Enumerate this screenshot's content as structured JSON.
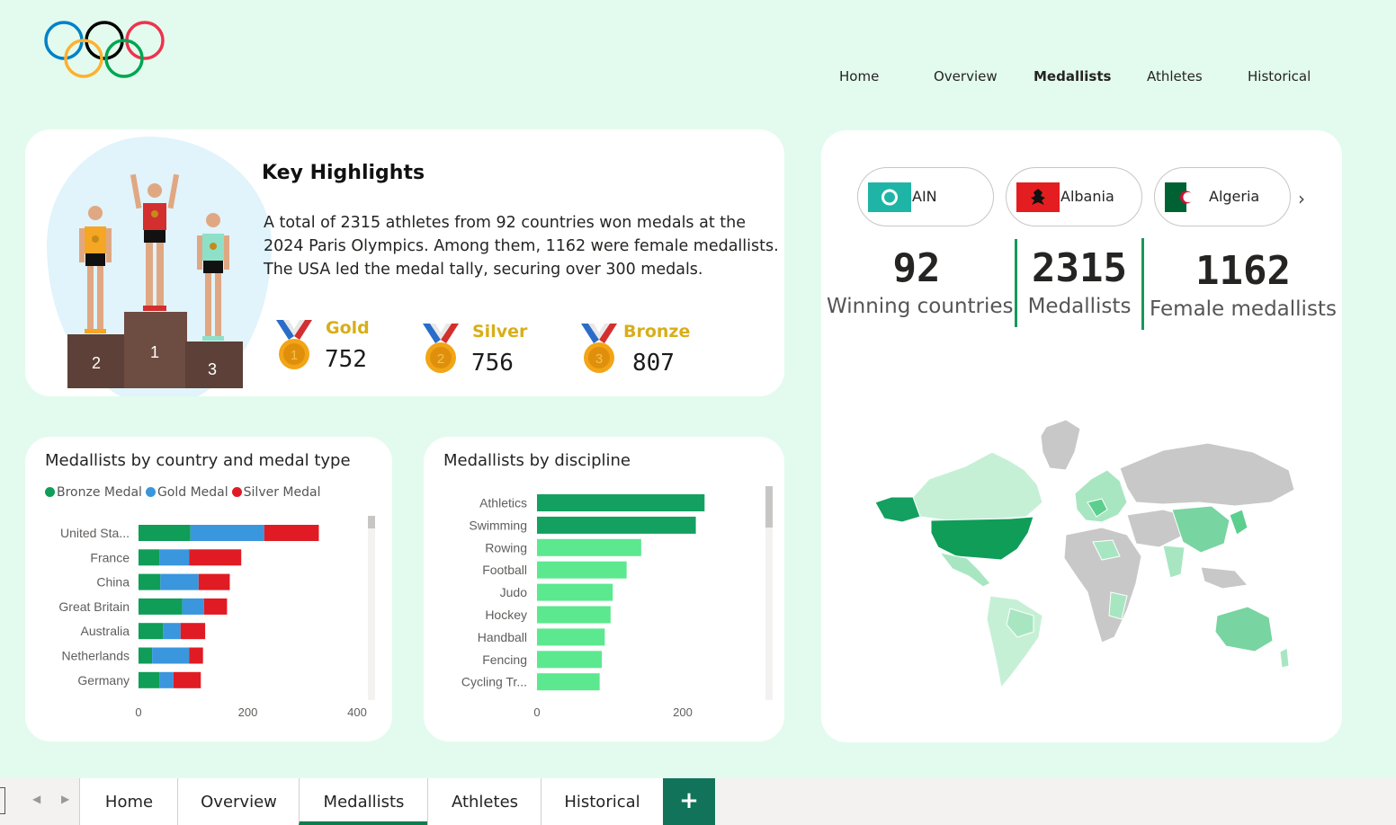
{
  "nav": {
    "items": [
      "Home",
      "Overview",
      "Medallists",
      "Athletes",
      "Historical"
    ],
    "active": "Medallists"
  },
  "highlights": {
    "title": "Key Highlights",
    "body": "A total of 2315 athletes from 92 countries won medals at the 2024 Paris Olympics. Among them, 1162 were female medallists. The USA led the medal tally, securing over 300 medals.",
    "podium": [
      "2",
      "1",
      "3"
    ],
    "medals": [
      {
        "label": "Gold",
        "value": "752",
        "number": "1"
      },
      {
        "label": "Silver",
        "value": "756",
        "number": "2"
      },
      {
        "label": "Bronze",
        "value": "807",
        "number": "3"
      }
    ]
  },
  "slicer": {
    "items": [
      {
        "label": "AIN",
        "flag": "ain-flag"
      },
      {
        "label": "Albania",
        "flag": "albania-flag"
      },
      {
        "label": "Algeria",
        "flag": "algeria-flag"
      }
    ],
    "next": "›"
  },
  "kpis": [
    {
      "value": "92",
      "label": "Winning countries"
    },
    {
      "value": "2315",
      "label": "Medallists"
    },
    {
      "value": "1162",
      "label": "Female medallists"
    }
  ],
  "colors": {
    "bronze": "#0f9d58",
    "gold": "#3a96dd",
    "silver": "#e01b24",
    "discipline_top": "#14a060",
    "discipline": "#5ce88e",
    "accent": "#0e7c4d"
  },
  "chart_data": [
    {
      "type": "bar",
      "title": "Medallists by country and medal type",
      "categories": [
        "United Sta...",
        "France",
        "China",
        "Great Britain",
        "Australia",
        "Netherlands",
        "Germany"
      ],
      "series": [
        {
          "name": "Bronze Medal",
          "values": [
            95,
            38,
            40,
            80,
            45,
            25,
            38
          ]
        },
        {
          "name": "Gold Medal",
          "values": [
            135,
            55,
            70,
            40,
            32,
            68,
            26
          ]
        },
        {
          "name": "Silver Medal",
          "values": [
            100,
            95,
            57,
            42,
            45,
            25,
            50
          ]
        }
      ],
      "xlim": [
        0,
        400
      ],
      "xticks": [
        "0",
        "200",
        "400"
      ]
    },
    {
      "type": "bar",
      "title": "Medallists by discipline",
      "categories": [
        "Athletics",
        "Swimming",
        "Rowing",
        "Football",
        "Judo",
        "Hockey",
        "Handball",
        "Fencing",
        "Cycling Tr..."
      ],
      "values": [
        230,
        218,
        143,
        123,
        104,
        101,
        93,
        89,
        86
      ],
      "xlim": [
        0,
        320
      ],
      "xticks": [
        "0",
        "200"
      ]
    }
  ],
  "tabs": {
    "items": [
      "Home",
      "Overview",
      "Medallists",
      "Athletes",
      "Historical"
    ],
    "active": "Medallists",
    "add": "+"
  }
}
